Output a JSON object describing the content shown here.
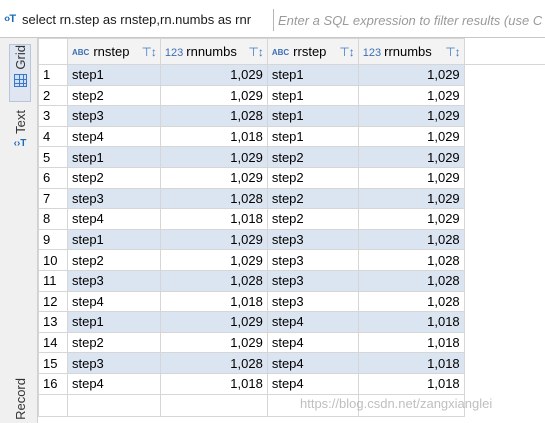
{
  "filter": {
    "icon": "filter-icon",
    "query": "select rn.step as rnstep,rn.numbs as rnr",
    "placeholder": "Enter a SQL expression to filter results (use Ctrl"
  },
  "sidebar": {
    "tabs": [
      {
        "label": "Grid",
        "icon": "grid-icon"
      },
      {
        "label": "Text",
        "icon": "text-icon"
      },
      {
        "label": "Record"
      }
    ]
  },
  "columns": [
    {
      "type_tag": "ABC",
      "name": "rnstep"
    },
    {
      "type_tag": "123",
      "name": "rnnumbs"
    },
    {
      "type_tag": "ABC",
      "name": "rrstep"
    },
    {
      "type_tag": "123",
      "name": "rrnumbs"
    }
  ],
  "rows": [
    {
      "n": "1",
      "c": [
        "step1",
        "1,029",
        "step1",
        "1,029"
      ]
    },
    {
      "n": "2",
      "c": [
        "step2",
        "1,029",
        "step1",
        "1,029"
      ]
    },
    {
      "n": "3",
      "c": [
        "step3",
        "1,028",
        "step1",
        "1,029"
      ]
    },
    {
      "n": "4",
      "c": [
        "step4",
        "1,018",
        "step1",
        "1,029"
      ]
    },
    {
      "n": "5",
      "c": [
        "step1",
        "1,029",
        "step2",
        "1,029"
      ]
    },
    {
      "n": "6",
      "c": [
        "step2",
        "1,029",
        "step2",
        "1,029"
      ]
    },
    {
      "n": "7",
      "c": [
        "step3",
        "1,028",
        "step2",
        "1,029"
      ]
    },
    {
      "n": "8",
      "c": [
        "step4",
        "1,018",
        "step2",
        "1,029"
      ]
    },
    {
      "n": "9",
      "c": [
        "step1",
        "1,029",
        "step3",
        "1,028"
      ]
    },
    {
      "n": "10",
      "c": [
        "step2",
        "1,029",
        "step3",
        "1,028"
      ]
    },
    {
      "n": "11",
      "c": [
        "step3",
        "1,028",
        "step3",
        "1,028"
      ]
    },
    {
      "n": "12",
      "c": [
        "step4",
        "1,018",
        "step3",
        "1,028"
      ]
    },
    {
      "n": "13",
      "c": [
        "step1",
        "1,029",
        "step4",
        "1,018"
      ]
    },
    {
      "n": "14",
      "c": [
        "step2",
        "1,029",
        "step4",
        "1,018"
      ]
    },
    {
      "n": "15",
      "c": [
        "step3",
        "1,028",
        "step4",
        "1,018"
      ]
    },
    {
      "n": "16",
      "c": [
        "step4",
        "1,018",
        "step4",
        "1,018"
      ]
    }
  ],
  "watermark": "https://blog.csdn.net/zangxianglei",
  "colors": {
    "alt_row": "#dbe4f1",
    "accent": "#3b78c4"
  }
}
